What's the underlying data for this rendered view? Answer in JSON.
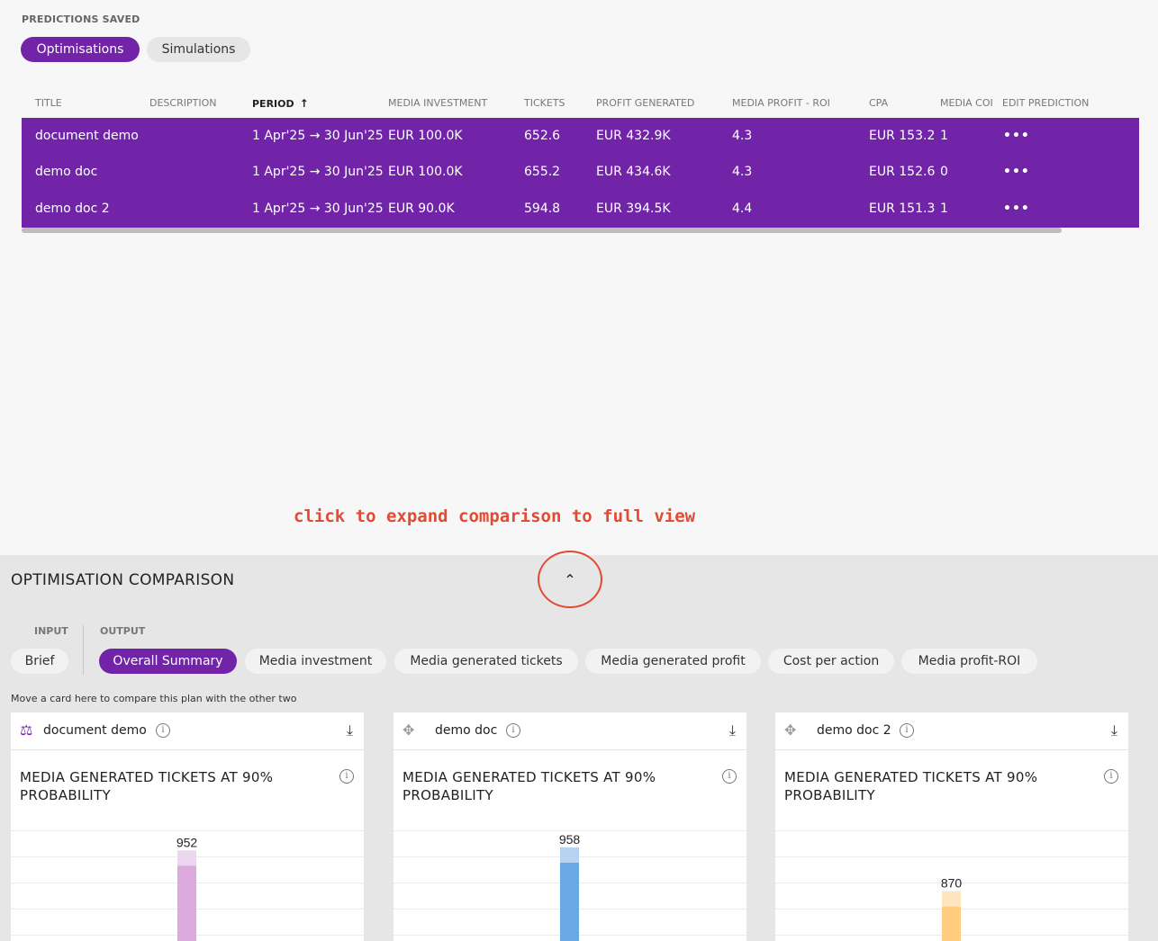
{
  "predictions": {
    "section_label": "PREDICTIONS SAVED",
    "tabs": [
      "Optimisations",
      "Simulations"
    ],
    "columns": [
      "TITLE",
      "DESCRIPTION",
      "PERIOD",
      "MEDIA INVESTMENT",
      "TICKETS",
      "PROFIT GENERATED",
      "MEDIA PROFIT - ROI",
      "CPA",
      "MEDIA COI",
      "EDIT PREDICTION"
    ],
    "rows": [
      {
        "title": "document demo",
        "description": "",
        "period": "1 Apr'25 → 30 Jun'25",
        "investment": "EUR 100.0K",
        "tickets": "652.6",
        "profit": "EUR 432.9K",
        "roi": "4.3",
        "cpa": "EUR 153.2",
        "coi": "1",
        "edit": "•••"
      },
      {
        "title": "demo doc",
        "description": "",
        "period": "1 Apr'25 → 30 Jun'25",
        "investment": "EUR 100.0K",
        "tickets": "655.2",
        "profit": "EUR 434.6K",
        "roi": "4.3",
        "cpa": "EUR 152.6",
        "coi": "0",
        "edit": "•••"
      },
      {
        "title": "demo doc 2",
        "description": "",
        "period": "1 Apr'25 → 30 Jun'25",
        "investment": "EUR 90.0K",
        "tickets": "594.8",
        "profit": "EUR 394.5K",
        "roi": "4.4",
        "cpa": "EUR 151.3",
        "coi": "1",
        "edit": "•••"
      }
    ]
  },
  "hint": "click to expand comparison to full view",
  "comparison": {
    "title": "OPTIMISATION COMPARISON",
    "input_label": "INPUT",
    "output_label": "OUTPUT",
    "input_tabs": [
      "Brief"
    ],
    "output_tabs": [
      "Overall Summary",
      "Media investment",
      "Media generated tickets",
      "Media generated profit",
      "Cost per action",
      "Media profit-ROI"
    ],
    "move_hint": "Move a card here to compare this plan with the other two",
    "cards": [
      {
        "name": "document demo",
        "metric": "MEDIA GENERATED TICKETS AT 90% PROBABILITY",
        "value": "952",
        "value_num": 952,
        "color": "#dcaadf",
        "light": "#efd6f0",
        "dark": "#c06dca"
      },
      {
        "name": "demo doc",
        "metric": "MEDIA GENERATED TICKETS AT 90% PROBABILITY",
        "value": "958",
        "value_num": 958,
        "color": "#6aa8e4",
        "light": "#b6d4f2",
        "dark": "#1b6fc4"
      },
      {
        "name": "demo doc 2",
        "metric": "MEDIA GENERATED TICKETS AT 90% PROBABILITY",
        "value": "870",
        "value_num": 870,
        "color": "#ffcc80",
        "light": "#ffe4c0",
        "dark": "#f4a63a"
      }
    ]
  }
}
